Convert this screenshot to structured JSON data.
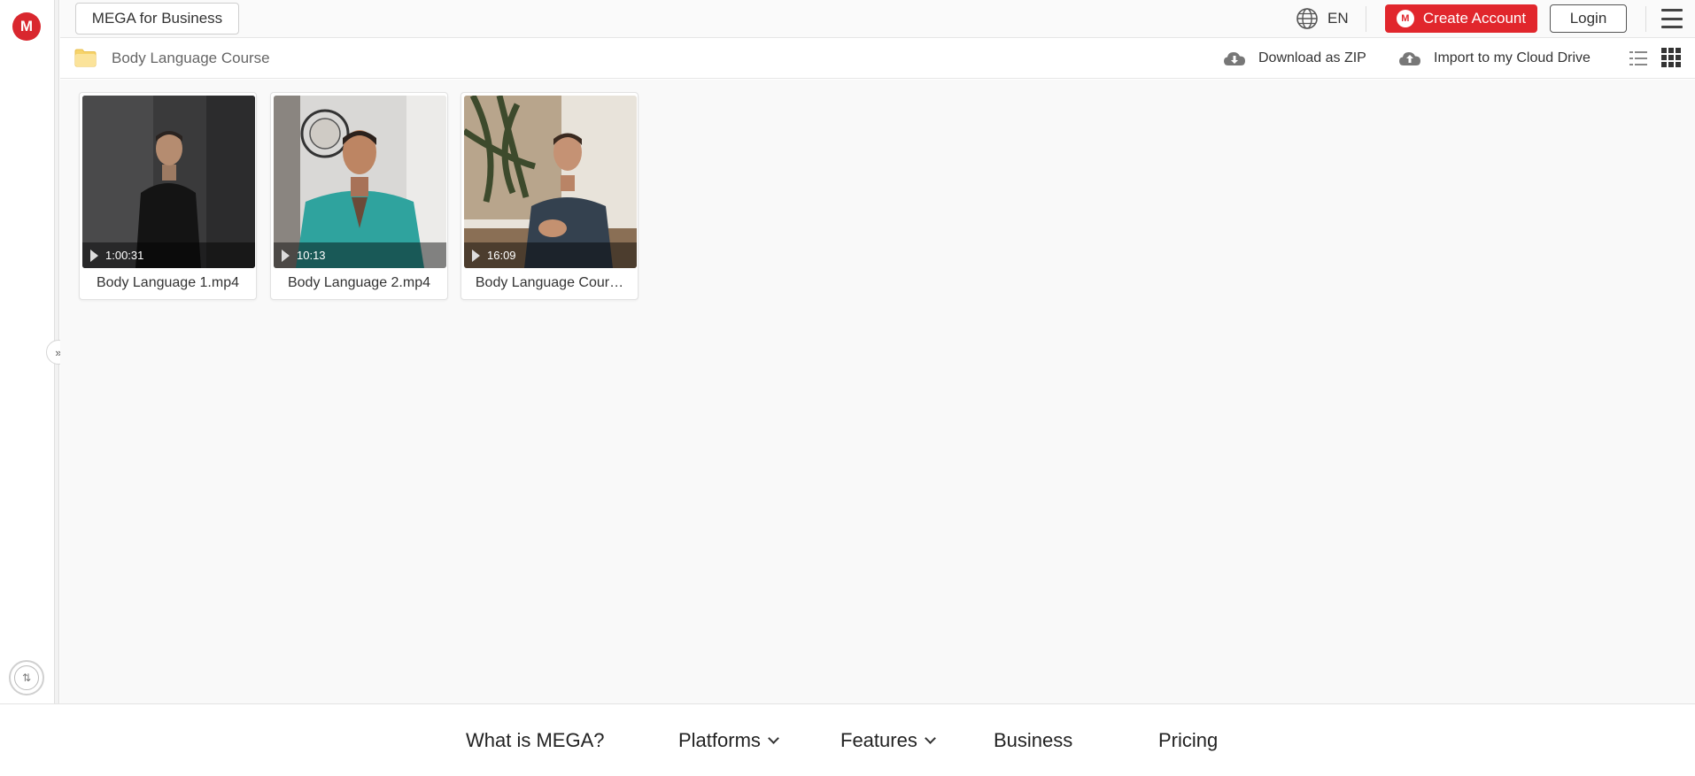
{
  "header": {
    "business_label": "MEGA for Business",
    "language": "EN",
    "create_account_label": "Create Account",
    "login_label": "Login"
  },
  "folder": {
    "name": "Body Language Course",
    "download_label": "Download as ZIP",
    "import_label": "Import to my Cloud Drive"
  },
  "files": [
    {
      "name": "Body Language 1.mp4",
      "duration": "1:00:31"
    },
    {
      "name": "Body Language 2.mp4",
      "duration": "10:13"
    },
    {
      "name": "Body Language Cour…",
      "duration": "16:09"
    }
  ],
  "footer": {
    "items": [
      {
        "label": "What is MEGA?"
      },
      {
        "label": "Platforms"
      },
      {
        "label": "Features"
      },
      {
        "label": "Business"
      },
      {
        "label": "Pricing"
      }
    ]
  },
  "colors": {
    "brand_red": "#d9272e",
    "create_button": "#e1262c",
    "folder_yellow": "#f6d36b"
  },
  "icons": {
    "logo": "mega-logo-icon",
    "language": "globe-icon",
    "menu": "hamburger-menu-icon",
    "folder": "folder-icon",
    "download": "cloud-download-icon",
    "import": "cloud-import-icon",
    "list_view": "list-view-icon",
    "grid_view": "grid-view-icon",
    "expand": "expand-sidebar-icon",
    "transfers": "transfers-icon",
    "play": "play-icon"
  }
}
